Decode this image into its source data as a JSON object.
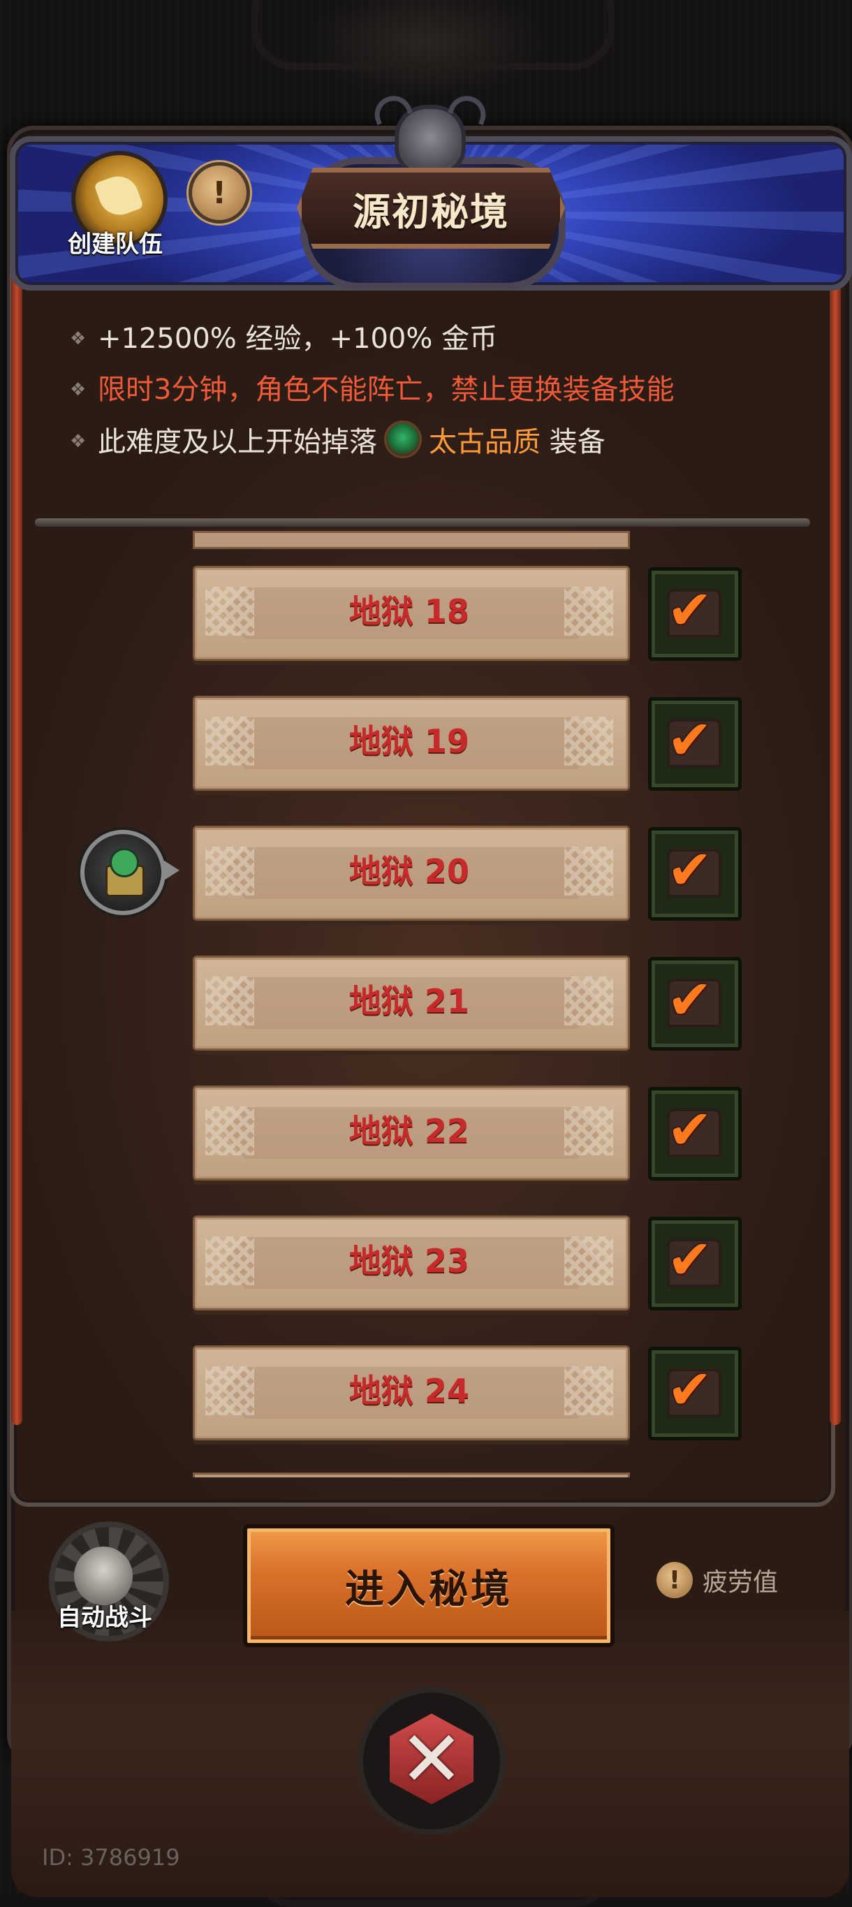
{
  "header": {
    "title": "源初秘境",
    "team_button_label": "创建队伍",
    "info_icon": "!"
  },
  "info": {
    "line1": "+12500% 经验，+100% 金币",
    "line2": "限时3分钟，角色不能阵亡，禁止更换装备技能",
    "line3_prefix": "此难度及以上开始掉落",
    "line3_quality": "太古品质",
    "line3_suffix": "装备",
    "bullet": "❖"
  },
  "levels": [
    {
      "label": "地狱 18",
      "check": "✔"
    },
    {
      "label": "地狱 19",
      "check": "✔"
    },
    {
      "label": "地狱 20",
      "check": "✔"
    },
    {
      "label": "地狱 21",
      "check": "✔"
    },
    {
      "label": "地狱 22",
      "check": "✔"
    },
    {
      "label": "地狱 23",
      "check": "✔"
    },
    {
      "label": "地狱 24",
      "check": "✔"
    }
  ],
  "current_level_index": 2,
  "bottom": {
    "auto_battle_label": "自动战斗",
    "enter_button_label": "进入秘境",
    "fatigue_label": "疲劳值",
    "fatigue_icon": "!"
  },
  "close_icon": "✕",
  "user_id": "ID: 3786919",
  "colors": {
    "level_text": "#c72a2a",
    "warning_text": "#f05a38",
    "quality_highlight": "#ff9a3a",
    "check_mark": "#ff7a1e",
    "enter_button": "#d9702a"
  }
}
